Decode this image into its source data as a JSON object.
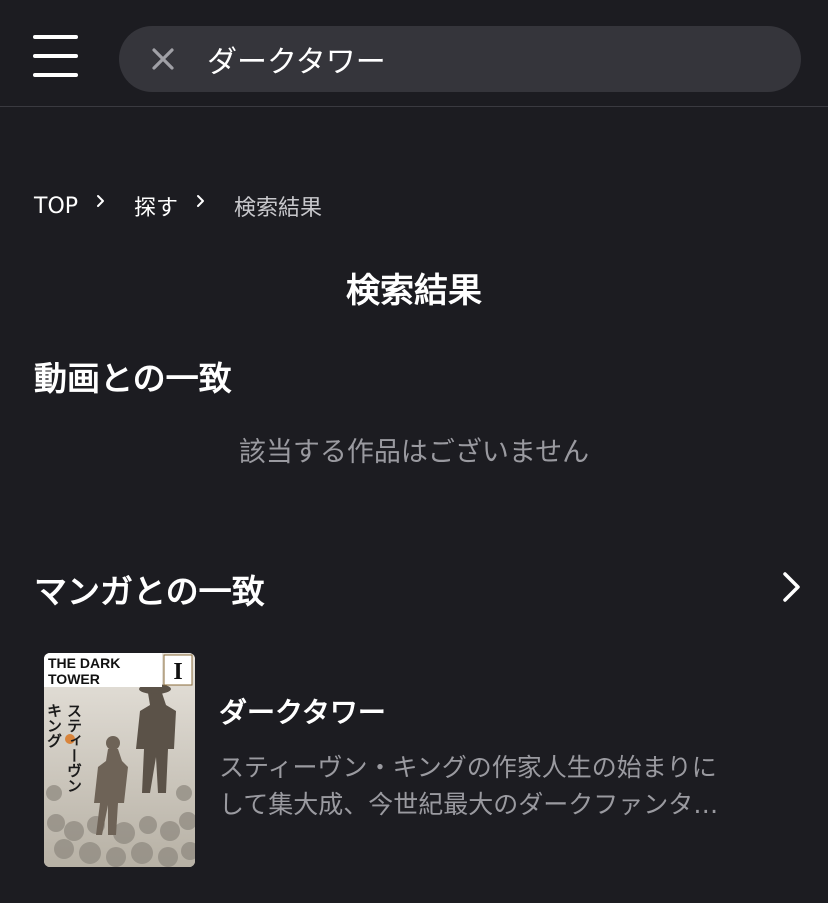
{
  "header": {
    "menu_icon": "hamburger-menu-icon",
    "clear_icon": "close-icon",
    "search_value": "ダークタワー"
  },
  "breadcrumb": {
    "items": [
      "TOP",
      "探す",
      "検索結果"
    ],
    "separator_icon": "chevron-right-icon"
  },
  "page": {
    "title": "検索結果"
  },
  "video_section": {
    "title": "動画との一致",
    "empty_message": "該当する作品はございません"
  },
  "manga_section": {
    "title": "マンガとの一致",
    "more_icon": "chevron-right-icon",
    "items": [
      {
        "title": "ダークタワー",
        "description": "スティーヴン・キングの作家人生の始まりにして集大成、今世紀最大のダークファンタジー",
        "cover": {
          "title_en": [
            "THE DARK",
            "TOWER"
          ],
          "volume": "I",
          "title_jp": [
            "キング",
            "スティーヴン"
          ]
        }
      }
    ]
  },
  "colors": {
    "background": "#1c1c21",
    "search_box": "#35353b",
    "muted_text": "#9a9aa0",
    "text": "#ffffff"
  }
}
